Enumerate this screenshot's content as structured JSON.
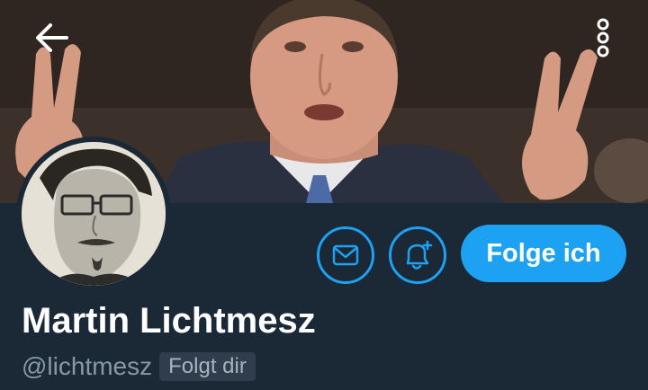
{
  "header": {
    "back_icon": "arrow-left-icon",
    "more_icon": "vertical-dots-icon"
  },
  "profile": {
    "display_name": "Martin Lichtmesz",
    "handle": "@lichtmesz",
    "follows_you_badge": "Folgt dir",
    "follow_button_label": "Folge ich",
    "message_icon": "envelope-icon",
    "notify_icon": "bell-plus-icon"
  },
  "colors": {
    "background": "#1b2836",
    "accent": "#1da1f2",
    "text_primary": "#ffffff",
    "text_secondary": "#8899a6",
    "badge_bg": "#2f3d4c"
  }
}
